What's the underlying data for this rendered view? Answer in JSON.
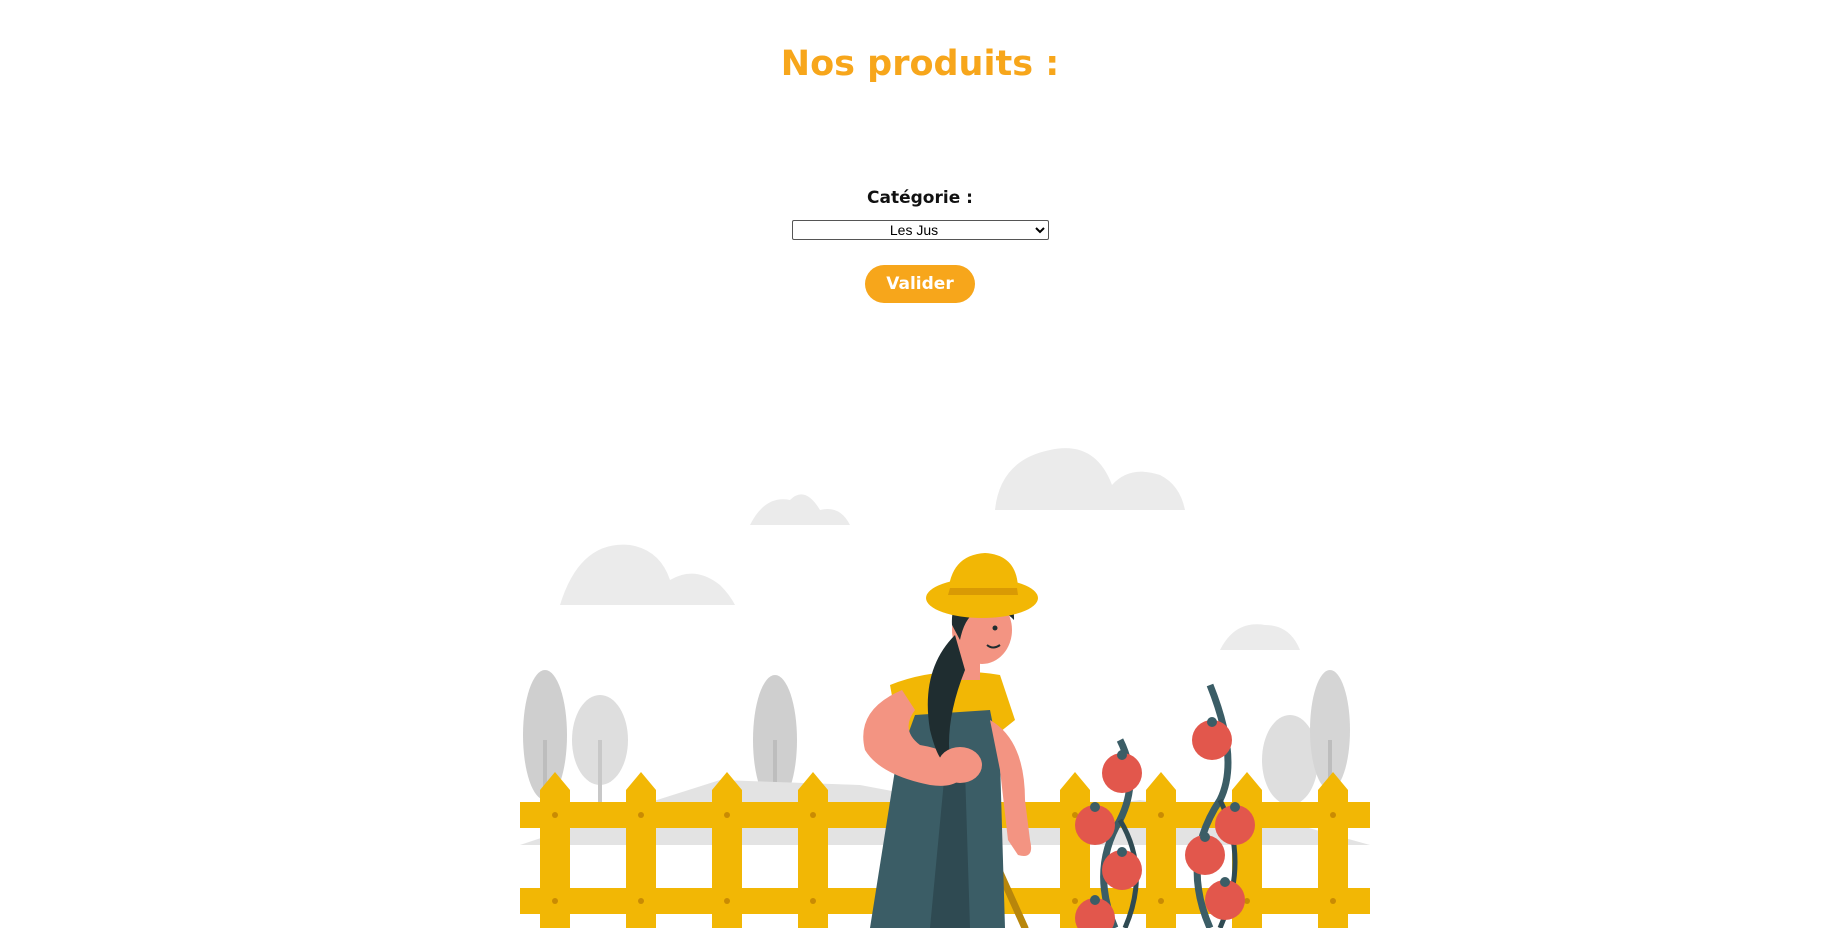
{
  "heading": {
    "title": "Nos produits :"
  },
  "filter": {
    "label": "Catégorie :",
    "selected_option": "Les Jus",
    "submit_label": "Valider"
  },
  "illustration": {
    "subject": "farmer-with-tomato-plants-illustration"
  },
  "colors": {
    "accent": "#F7A61B",
    "fence": "#F2B705",
    "fence_dark": "#D99A04",
    "overalls": "#3B5D66",
    "skin": "#F39482",
    "tomato": "#E2574C",
    "cloud": "#EBEBEB",
    "tree": "#D9D9D9"
  }
}
